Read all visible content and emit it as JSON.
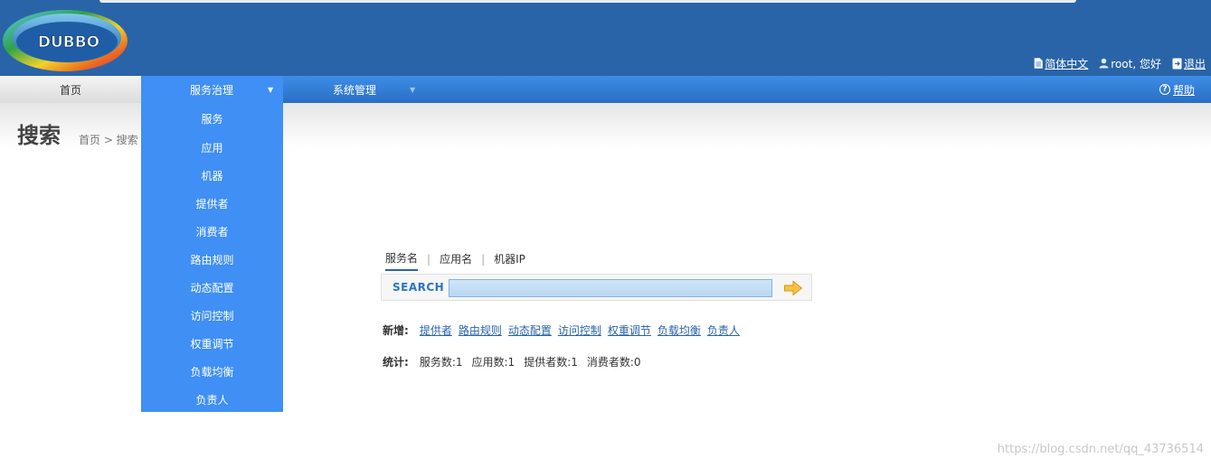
{
  "header": {
    "logo_text": "DUBBO",
    "language": "简体中文",
    "user_greeting": "root, 您好",
    "logout": "退出"
  },
  "nav": {
    "home": "首页",
    "governance": "服务治理",
    "system": "系统管理",
    "help": "帮助"
  },
  "page": {
    "title": "搜索",
    "breadcrumb": "首页 > 搜索"
  },
  "dropdown": {
    "items": [
      "服务",
      "应用",
      "机器",
      "提供者",
      "消费者",
      "路由规则",
      "动态配置",
      "访问控制",
      "权重调节",
      "负载均衡",
      "负责人"
    ]
  },
  "search": {
    "tabs": [
      "服务名",
      "应用名",
      "机器IP"
    ],
    "separator": "|",
    "label": "SEARCH",
    "value": "",
    "placeholder": ""
  },
  "add_row": {
    "label": "新增:",
    "links": [
      "提供者",
      "路由规则",
      "动态配置",
      "访问控制",
      "权重调节",
      "负载均衡",
      "负责人"
    ]
  },
  "stats_row": {
    "label": "统计:",
    "items": [
      "服务数:1",
      "应用数:1",
      "提供者数:1",
      "消费者数:0"
    ]
  },
  "watermark": "https://blog.csdn.net/qq_43736514",
  "colors": {
    "header_bg": "#2a64a8",
    "menu_bg": "#3f8ff5",
    "link": "#2a64a8"
  }
}
